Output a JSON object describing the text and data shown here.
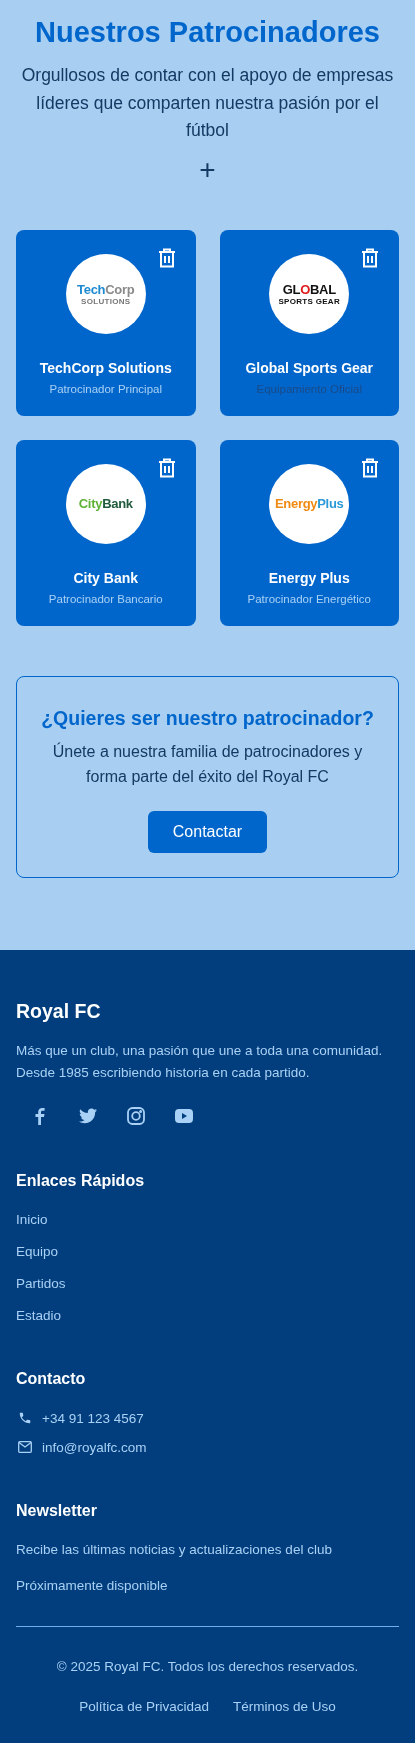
{
  "sponsors": {
    "title": "Nuestros Patrocinadores",
    "subtitle": "Orgullosos de contar con el apoyo de empresas líderes que comparten nuestra pasión por el fútbol",
    "add_button": "+",
    "cards": [
      {
        "name": "TechCorp Solutions",
        "role": "Patrocinador Principal",
        "hovered": false,
        "logo": [
          {
            "kind": "large",
            "parts": [
              {
                "text": "Tech",
                "color": "#1e8ad0"
              },
              {
                "text": "Corp",
                "color": "#8a8a8a"
              }
            ]
          },
          {
            "kind": "small",
            "parts": [
              {
                "text": "SOLUTIONS",
                "color": "#777777"
              }
            ]
          }
        ]
      },
      {
        "name": "Global Sports Gear",
        "role": "Equipamiento Oficial",
        "hovered": true,
        "logo": [
          {
            "kind": "large",
            "parts": [
              {
                "text": "GL",
                "color": "#111111"
              },
              {
                "text": "O",
                "color": "#e01b1b"
              },
              {
                "text": "BAL",
                "color": "#111111"
              }
            ]
          },
          {
            "kind": "small",
            "parts": [
              {
                "text": "SPORTS GEAR",
                "color": "#111111"
              }
            ]
          }
        ]
      },
      {
        "name": "City Bank",
        "role": "Patrocinador Bancario",
        "hovered": false,
        "logo": [
          {
            "kind": "large",
            "parts": [
              {
                "text": "City",
                "color": "#5fb236"
              },
              {
                "text": "Bank",
                "color": "#1f5a3a"
              }
            ]
          }
        ]
      },
      {
        "name": "Energy Plus",
        "role": "Patrocinador Energético",
        "hovered": false,
        "logo": [
          {
            "kind": "large",
            "parts": [
              {
                "text": "Energy",
                "color": "#f08a12"
              },
              {
                "text": "Plus",
                "color": "#2a9ad8"
              }
            ]
          }
        ]
      }
    ]
  },
  "cta": {
    "title": "¿Quieres ser nuestro patrocinador?",
    "text": "Únete a nuestra familia de patrocinadores y forma parte del éxito del Royal FC",
    "button": "Contactar"
  },
  "footer": {
    "brand": "Royal FC",
    "about": "Más que un club, una pasión que une a toda una comunidad. Desde 1985 escribiendo historia en cada partido.",
    "social": [
      {
        "kind": "facebook"
      },
      {
        "kind": "twitter"
      },
      {
        "kind": "instagram"
      },
      {
        "kind": "youtube"
      }
    ],
    "links_title": "Enlaces Rápidos",
    "links": [
      "Inicio",
      "Equipo",
      "Partidos",
      "Estadio"
    ],
    "contact_title": "Contacto",
    "contacts": [
      {
        "kind": "phone",
        "text": "+34 91 123 4567"
      },
      {
        "kind": "email",
        "text": "info@royalfc.com"
      }
    ],
    "newsletter_title": "Newsletter",
    "newsletter_text": "Recibe las últimas noticias y actualizaciones del club",
    "newsletter_note": "Próximamente disponible",
    "copyright": "© 2025 Royal FC. Todos los derechos reservados.",
    "legal_links": [
      "Política de Privacidad",
      "Términos de Uso"
    ]
  }
}
